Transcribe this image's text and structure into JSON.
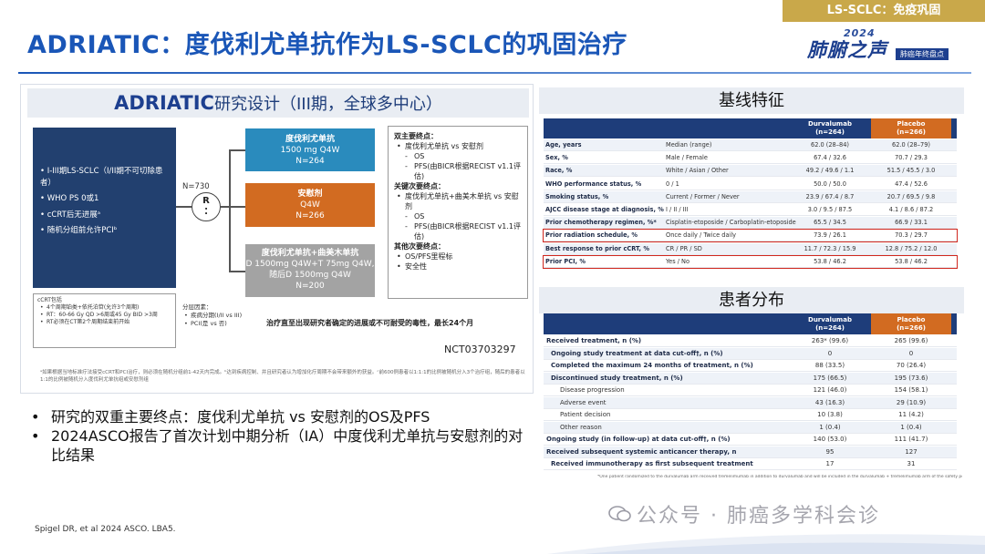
{
  "header": {
    "tag": "LS-SCLC：免疫巩固",
    "title": "ADRIATIC：度伐利尤单抗作为LS-SCLC的巩固治疗",
    "logo_year": "2024",
    "logo_main": "肺腑之声",
    "logo_sub": "肺癌年终盘点"
  },
  "design": {
    "title_bold": "ADRIATIC",
    "title_rest": "研究设计（III期，全球多中心）",
    "eligibility": [
      "I-III期LS-SCLC（I/II期不可切除患者）",
      "WHO PS 0或1",
      "cCRT后无进展ᵃ",
      "随机分组前允许PCIᵇ"
    ],
    "n_total": "N=730",
    "randomization_label": "R",
    "randomization_sub": "⁚",
    "arms": [
      {
        "name": "度伐利尤单抗",
        "dose": "1500 mg Q4W",
        "n": "N=264"
      },
      {
        "name": "安慰剂",
        "dose": "Q4W",
        "n": "N=266"
      },
      {
        "name": "度伐利尤单抗+曲美木单抗",
        "dose": "D 1500mg Q4W+T 75mg Q4W,",
        "dose2": "随后D 1500mg Q4W",
        "n": "N=200"
      }
    ],
    "endpoints": [
      {
        "type": "hd",
        "text": "双主要终点："
      },
      {
        "type": "it",
        "text": "度伐利尤单抗 vs 安慰剂"
      },
      {
        "type": "sub",
        "text": "OS"
      },
      {
        "type": "sub",
        "text": "PFS(由BICR根据RECIST v1.1评估)"
      },
      {
        "type": "hd",
        "text": "关键次要终点："
      },
      {
        "type": "it",
        "text": "度伐利尤单抗+曲美木单抗 vs 安慰剂"
      },
      {
        "type": "sub",
        "text": "OS"
      },
      {
        "type": "sub",
        "text": "PFS(由BICR根据RECIST v1.1评估)"
      },
      {
        "type": "hd",
        "text": "其他次要终点："
      },
      {
        "type": "it",
        "text": "OS/PFS里程标"
      },
      {
        "type": "it",
        "text": "安全性"
      }
    ],
    "crt_title": "cCRT包括",
    "crt_items": [
      "4个周期铂类+依托泊苷(允许3个周期)",
      "RT：60-66 Gy QD >6周或45 Gy BID >3周",
      "RT必须在CT第2个周期结束前开始"
    ],
    "strat_title": "分层因素：",
    "strat_items": [
      "疾病分期(I/II vs III)",
      "PCI(是 vs 否)"
    ],
    "treat_note": "治疗直至出现研究者确定的进展或不可耐受的毒性，最长24个月",
    "nct": "NCT03703297",
    "footnote": "ᵃ如果根据当地标准疗法接受cCRT和PCI治疗，则必须在随机分组前1-42天内完成。ᵇ达到疾病控制、并且研究者认为增加化疗周期不会带来额外的获益。ᶜ前600例患者以1:1:1的比例被随机分入3个治疗组，随后的患者以1:1的比例被随机分入度伐利尤单抗组或安慰剂组"
  },
  "summary": {
    "bullets": [
      "研究的双重主要终点：度伐利尤单抗 vs 安慰剂的OS及PFS",
      "2024ASCO报告了首次计划中期分析（IA）中度伐利尤单抗与安慰剂的对比结果"
    ],
    "reference": "Spigel DR, et al 2024 ASCO. LBA5."
  },
  "baseline": {
    "title": "基线特征",
    "col_d": "Durvalumab",
    "col_d_n": "(n=264)",
    "col_p": "Placebo",
    "col_p_n": "(n=266)",
    "rows": [
      {
        "label": "Age, years",
        "measure": "Median (range)",
        "d": "62.0 (28–84)",
        "p": "62.0 (28–79)"
      },
      {
        "label": "Sex, %",
        "measure": "Male / Female",
        "d": "67.4 / 32.6",
        "p": "70.7 / 29.3"
      },
      {
        "label": "Race, %",
        "measure": "White / Asian / Other",
        "d": "49.2 / 49.6 / 1.1",
        "p": "51.5 / 45.5 / 3.0"
      },
      {
        "label": "WHO performance status, %",
        "measure": "0 / 1",
        "d": "50.0 / 50.0",
        "p": "47.4 / 52.6"
      },
      {
        "label": "Smoking status, %",
        "measure": "Current / Former / Never",
        "d": "23.9 / 67.4 / 8.7",
        "p": "20.7 / 69.5 / 9.8"
      },
      {
        "label": "AJCC disease stage at diagnosis, %",
        "measure": "I / II / III",
        "d": "3.0 / 9.5 / 87.5",
        "p": "4.1 / 8.6 / 87.2"
      },
      {
        "label": "Prior chemotherapy regimen, %*",
        "measure": "Cisplatin-etoposide / Carboplatin-etoposide",
        "d": "65.5 / 34.5",
        "p": "66.9 / 33.1"
      },
      {
        "label": "Prior radiation schedule, %",
        "measure": "Once daily / Twice daily",
        "d": "73.9 / 26.1",
        "p": "70.3 / 29.7",
        "hl": true
      },
      {
        "label": "Best response to prior cCRT, %",
        "measure": "CR / PR / SD",
        "d": "11.7 / 72.3 / 15.9",
        "p": "12.8 / 75.2 / 12.0"
      },
      {
        "label": "Prior PCI, %",
        "measure": "Yes / No",
        "d": "53.8 / 46.2",
        "p": "53.8 / 46.2",
        "hl": true
      }
    ]
  },
  "disposition": {
    "title": "患者分布",
    "col_d": "Durvalumab",
    "col_d_n": "(n=264)",
    "col_p": "Placebo",
    "col_p_n": "(n=266)",
    "rows": [
      {
        "level": 0,
        "label": "Received treatment, n (%)",
        "d": "263* (99.6)",
        "p": "265 (99.6)"
      },
      {
        "level": 1,
        "label": "Ongoing study treatment at data cut-off†, n (%)",
        "d": "0",
        "p": "0"
      },
      {
        "level": 1,
        "label": "Completed the maximum 24 months of treatment, n (%)",
        "d": "88 (33.5)",
        "p": "70 (26.4)"
      },
      {
        "level": 1,
        "label": "Discontinued study treatment, n (%)",
        "d": "175 (66.5)",
        "p": "195 (73.6)"
      },
      {
        "level": 2,
        "label": "Disease progression",
        "d": "121 (46.0)",
        "p": "154 (58.1)"
      },
      {
        "level": 2,
        "label": "Adverse event",
        "d": "43 (16.3)",
        "p": "29 (10.9)"
      },
      {
        "level": 2,
        "label": "Patient decision",
        "d": "10 (3.8)",
        "p": "11 (4.2)"
      },
      {
        "level": 2,
        "label": "Other reason",
        "d": "1 (0.4)",
        "p": "1 (0.4)"
      },
      {
        "level": 0,
        "label": "Ongoing study (in follow-up) at data cut-off†, n (%)",
        "d": "140 (53.0)",
        "p": "111 (41.7)"
      },
      {
        "level": 0,
        "label": "Received subsequent systemic anticancer therapy, n",
        "d": "95",
        "p": "127"
      },
      {
        "level": 1,
        "label": "Received immunotherapy as first subsequent treatment",
        "d": "17",
        "p": "31"
      }
    ],
    "footnote": "*One patient randomized to the durvalumab arm received tremelimumab in addition to durvalumab and will be included in the durvalumab + tremelimumab arm of the safety population. †Jan 15, 2024"
  },
  "watermark": {
    "text": "公众号 · 肺癌多学科会诊"
  },
  "colors": {
    "brand_blue": "#1a56b7",
    "navy": "#1e3d7a",
    "durva_arm": "#2a8bbd",
    "placebo_arm": "#d26b21",
    "combo_arm": "#a3a3a3",
    "gold_tag": "#c9a84a",
    "highlight": "#d0271e"
  }
}
